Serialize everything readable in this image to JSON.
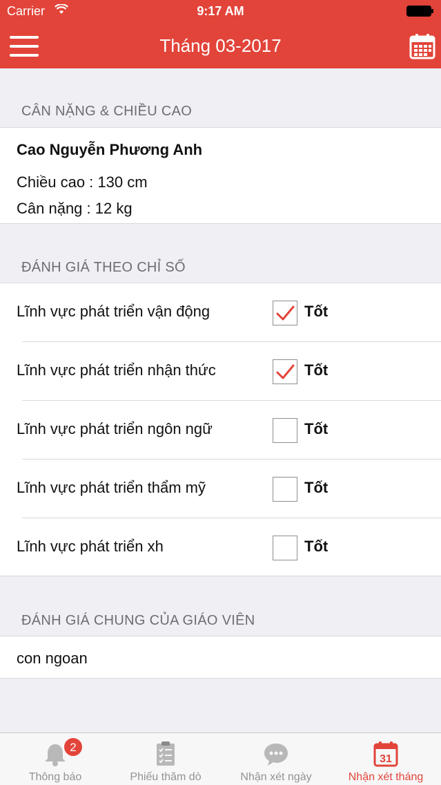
{
  "status_bar": {
    "carrier": "Carrier",
    "time": "9:17 AM"
  },
  "nav": {
    "title": "Tháng 03-2017",
    "menu_icon": "hamburger-menu-icon",
    "right_icon": "calendar-icon"
  },
  "colors": {
    "accent": "#e2443a",
    "background": "#efeff4",
    "section_text": "#6d6d72",
    "tab_inactive": "#929292"
  },
  "section_measure": {
    "header": "CÂN NẶNG & CHIỀU CAO",
    "student_name": "Cao Nguyễn Phương Anh",
    "height_text": "Chiều cao : 130 cm",
    "weight_text": "Cân nặng : 12 kg"
  },
  "section_assessment": {
    "header": "ĐÁNH GIÁ THEO CHỈ SỐ",
    "rows": [
      {
        "label": "Lĩnh vực phát triển vận động",
        "checked": true,
        "value": "Tốt"
      },
      {
        "label": "Lĩnh vực phát triển nhận thức",
        "checked": true,
        "value": "Tốt"
      },
      {
        "label": "Lĩnh vực phát triển ngôn ngữ",
        "checked": false,
        "value": "Tốt"
      },
      {
        "label": "Lĩnh vực phát triển thẩm mỹ",
        "checked": false,
        "value": "Tốt"
      },
      {
        "label": "Lĩnh vực phát triển xh",
        "checked": false,
        "value": "Tốt"
      }
    ]
  },
  "section_teacher": {
    "header": "ĐÁNH GIÁ CHUNG CỦA GIÁO VIÊN",
    "comment": "con ngoan"
  },
  "tab_bar": {
    "tabs": [
      {
        "label": "Thông báo",
        "icon": "bell-icon",
        "badge": "2",
        "active": false
      },
      {
        "label": "Phiếu thăm dò",
        "icon": "checklist-icon",
        "active": false
      },
      {
        "label": "Nhận xét ngày",
        "icon": "chat-bubble-icon",
        "active": false
      },
      {
        "label": "Nhận xét tháng",
        "icon": "calendar-31-icon",
        "active": true
      }
    ]
  }
}
